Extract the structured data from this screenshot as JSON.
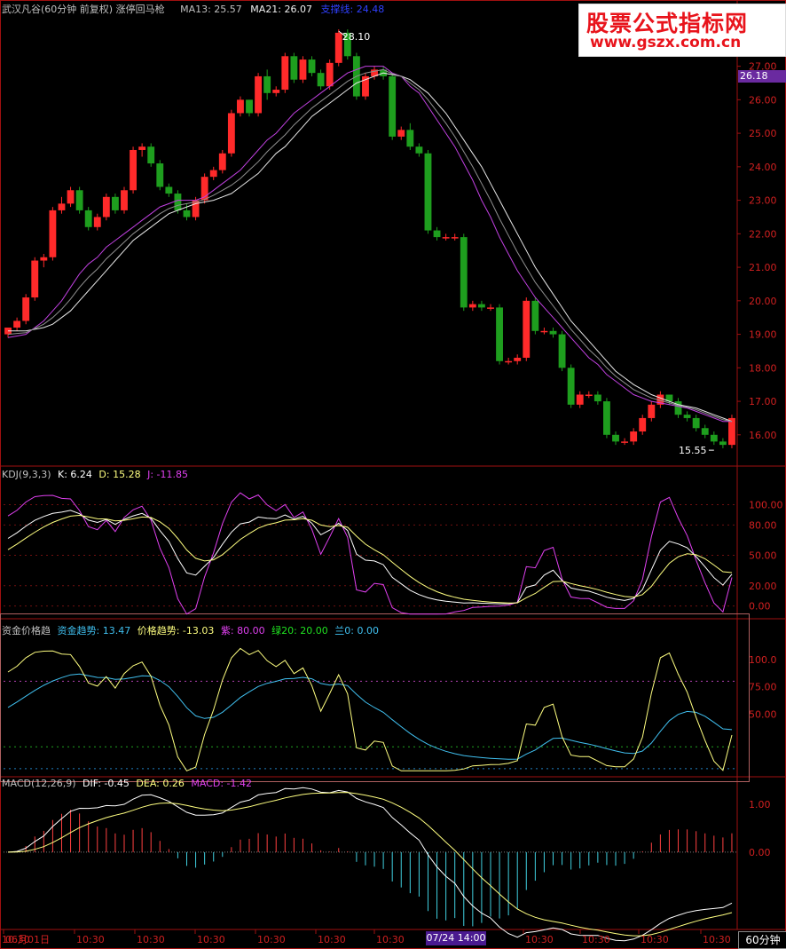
{
  "main_header": {
    "title": "武汉凡谷(60分钟 前复权) 涨停回马枪",
    "ma13_label": "MA13: 25.57",
    "ma21_label": "MA21: 26.07",
    "support_label": "支撑线: 24.48"
  },
  "watermark": {
    "line1": "股票公式指标网",
    "line2": "www.gszx.com.cn"
  },
  "current_price": "26.18",
  "annotations": {
    "high": "28.10",
    "low": "15.55"
  },
  "kdj_header": {
    "name": "KDJ(9,3,3)",
    "k": "K: 6.24",
    "d": "D: 15.28",
    "j": "J: -11.85"
  },
  "fund_header": {
    "name": "资金价格趋",
    "fund": "资金趋势: 13.47",
    "price": "价格趋势: -13.03",
    "purple": "紫: 80.00",
    "green": "绿20: 20.00",
    "blue": "兰0: 0.00"
  },
  "macd_header": {
    "name": "MACD(12,26,9)",
    "dif": "DIF: -0.45",
    "dea": "DEA: 0.26",
    "macd": "MACD: -1.42"
  },
  "x_axis": {
    "labels": [
      "06月01日",
      "10:30",
      "10:30",
      "10:30",
      "10:30",
      "10:30",
      "10:30",
      "10:30",
      "07/24 14:00",
      "10:30",
      "10:30",
      "10:30",
      "10:30",
      "10:30"
    ],
    "highlight": "07/24 14:00",
    "period": "60分钟"
  },
  "colors": {
    "up": "#ff2a2a",
    "down": "#1e9e1e",
    "bg": "#000000",
    "border": "#a01010",
    "ma_white": "#e8e8e8",
    "ma_purple": "#c040e0",
    "ma_gray": "#909090",
    "kdj_k": "#ffffff",
    "kdj_d": "#ffff80",
    "kdj_j": "#e040f0",
    "fund_line": "#40c0f0",
    "price_line": "#ffff80",
    "macd_dif": "#ffffff",
    "macd_dea": "#ffff80",
    "macd_pos": "#ff4040",
    "macd_neg": "#40d0e0"
  },
  "chart_data": [
    {
      "type": "candlestick",
      "title": "武汉凡谷(60分钟 前复权)",
      "ylim": [
        15.2,
        28.5
      ],
      "yticks": [
        "27.00",
        "26.00",
        "25.00",
        "24.00",
        "23.00",
        "22.00",
        "21.00",
        "20.00",
        "19.00",
        "18.00",
        "17.00",
        "16.00"
      ],
      "candles": [
        [
          19.0,
          19.2,
          18.9,
          19.2
        ],
        [
          19.2,
          19.5,
          19.1,
          19.4
        ],
        [
          19.4,
          20.2,
          19.3,
          20.1
        ],
        [
          20.1,
          21.3,
          20.0,
          21.2
        ],
        [
          21.2,
          21.4,
          21.0,
          21.3
        ],
        [
          21.3,
          22.8,
          21.2,
          22.7
        ],
        [
          22.7,
          23.1,
          22.6,
          22.9
        ],
        [
          22.9,
          23.4,
          22.8,
          23.3
        ],
        [
          23.3,
          23.4,
          22.6,
          22.7
        ],
        [
          22.7,
          22.8,
          22.1,
          22.2
        ],
        [
          22.2,
          22.6,
          22.1,
          22.5
        ],
        [
          22.5,
          23.2,
          22.4,
          23.1
        ],
        [
          23.1,
          23.2,
          22.6,
          22.7
        ],
        [
          22.7,
          23.4,
          22.6,
          23.3
        ],
        [
          23.3,
          24.6,
          23.2,
          24.5
        ],
        [
          24.5,
          24.7,
          24.3,
          24.6
        ],
        [
          24.6,
          24.7,
          24.0,
          24.1
        ],
        [
          24.1,
          24.2,
          23.3,
          23.4
        ],
        [
          23.4,
          23.5,
          23.1,
          23.2
        ],
        [
          23.2,
          23.3,
          22.6,
          22.7
        ],
        [
          22.7,
          22.9,
          22.4,
          22.5
        ],
        [
          22.5,
          23.1,
          22.4,
          23.0
        ],
        [
          23.0,
          23.8,
          22.9,
          23.7
        ],
        [
          23.7,
          24.0,
          23.6,
          23.9
        ],
        [
          23.9,
          24.5,
          23.8,
          24.4
        ],
        [
          24.4,
          25.7,
          24.3,
          25.6
        ],
        [
          25.6,
          26.1,
          25.5,
          26.0
        ],
        [
          26.0,
          26.0,
          25.5,
          25.6
        ],
        [
          25.6,
          26.8,
          25.5,
          26.7
        ],
        [
          26.7,
          26.9,
          26.0,
          26.2
        ],
        [
          26.2,
          26.4,
          26.1,
          26.3
        ],
        [
          26.3,
          27.4,
          26.2,
          27.3
        ],
        [
          27.3,
          27.4,
          26.5,
          26.6
        ],
        [
          26.6,
          27.3,
          26.5,
          27.2
        ],
        [
          27.2,
          27.3,
          26.7,
          26.8
        ],
        [
          26.8,
          26.9,
          26.3,
          26.4
        ],
        [
          26.4,
          27.2,
          26.3,
          27.1
        ],
        [
          27.1,
          28.1,
          27.0,
          28.0
        ],
        [
          28.0,
          28.1,
          27.2,
          27.3
        ],
        [
          27.3,
          27.4,
          26.0,
          26.1
        ],
        [
          26.1,
          26.8,
          26.0,
          26.7
        ],
        [
          26.7,
          27.0,
          26.6,
          26.9
        ],
        [
          26.9,
          27.0,
          26.6,
          26.7
        ],
        [
          26.7,
          26.8,
          24.8,
          24.9
        ],
        [
          24.9,
          25.2,
          24.8,
          25.1
        ],
        [
          25.1,
          25.3,
          24.5,
          24.6
        ],
        [
          24.6,
          24.7,
          24.3,
          24.4
        ],
        [
          24.4,
          24.5,
          22.0,
          22.1
        ],
        [
          22.1,
          22.2,
          21.8,
          21.9
        ],
        [
          21.9,
          22.0,
          21.8,
          21.9
        ],
        [
          21.9,
          22.0,
          21.8,
          21.9
        ],
        [
          21.9,
          22.0,
          19.7,
          19.8
        ],
        [
          19.8,
          20.0,
          19.7,
          19.9
        ],
        [
          19.9,
          20.0,
          19.7,
          19.8
        ],
        [
          19.8,
          19.9,
          19.7,
          19.8
        ],
        [
          19.8,
          19.9,
          18.1,
          18.2
        ],
        [
          18.2,
          18.3,
          18.1,
          18.2
        ],
        [
          18.2,
          18.4,
          18.1,
          18.3
        ],
        [
          18.3,
          20.1,
          18.2,
          20.0
        ],
        [
          20.0,
          20.1,
          19.0,
          19.1
        ],
        [
          19.1,
          19.2,
          19.0,
          19.1
        ],
        [
          19.1,
          19.2,
          18.9,
          19.0
        ],
        [
          19.0,
          19.1,
          17.9,
          18.0
        ],
        [
          18.0,
          18.1,
          16.8,
          16.9
        ],
        [
          16.9,
          17.3,
          16.8,
          17.2
        ],
        [
          17.2,
          17.3,
          17.1,
          17.2
        ],
        [
          17.2,
          17.3,
          16.9,
          17.0
        ],
        [
          17.0,
          17.1,
          15.9,
          16.0
        ],
        [
          16.0,
          16.1,
          15.7,
          15.8
        ],
        [
          15.8,
          15.9,
          15.7,
          15.8
        ],
        [
          15.8,
          16.2,
          15.7,
          16.1
        ],
        [
          16.1,
          16.6,
          16.0,
          16.5
        ],
        [
          16.5,
          17.0,
          16.4,
          16.9
        ],
        [
          16.9,
          17.3,
          16.8,
          17.2
        ],
        [
          17.2,
          17.2,
          16.9,
          17.0
        ],
        [
          17.0,
          17.1,
          16.5,
          16.6
        ],
        [
          16.6,
          16.7,
          16.4,
          16.5
        ],
        [
          16.5,
          16.6,
          16.1,
          16.2
        ],
        [
          16.2,
          16.3,
          15.9,
          16.0
        ],
        [
          16.0,
          16.1,
          15.7,
          15.8
        ],
        [
          15.8,
          15.9,
          15.6,
          15.7
        ],
        [
          15.7,
          16.6,
          15.6,
          16.5
        ]
      ],
      "series": [
        {
          "name": "MA13",
          "values": [
            18.9,
            18.95,
            19.0,
            19.2,
            19.4,
            19.7,
            20.0,
            20.4,
            20.8,
            21.1,
            21.3,
            21.6,
            21.8,
            22.0,
            22.2,
            22.4,
            22.6,
            22.8,
            22.9,
            23.0,
            23.0,
            23.0,
            23.1,
            23.3,
            23.5,
            23.7,
            23.9,
            24.2,
            24.5,
            24.8,
            25.0,
            25.3,
            25.6,
            25.8,
            26.0,
            26.2,
            26.4,
            26.6,
            26.8,
            26.9,
            27.0,
            27.0,
            27.0,
            26.8,
            26.7,
            26.4,
            26.2,
            25.8,
            25.4,
            25.0,
            24.6,
            24.1,
            23.6,
            23.0,
            22.5,
            21.9,
            21.4,
            20.9,
            20.5,
            20.1,
            19.8,
            19.5,
            19.2,
            18.9,
            18.6,
            18.3,
            18.1,
            17.8,
            17.6,
            17.4,
            17.2,
            17.1,
            17.0,
            16.95,
            16.9,
            16.85,
            16.8,
            16.7,
            16.6,
            16.5,
            16.4,
            16.4
          ]
        },
        {
          "name": "MA21",
          "values": [
            19.1,
            19.1,
            19.1,
            19.15,
            19.2,
            19.3,
            19.5,
            19.7,
            20.0,
            20.3,
            20.6,
            20.9,
            21.2,
            21.5,
            21.8,
            22.0,
            22.2,
            22.4,
            22.6,
            22.7,
            22.8,
            22.9,
            22.95,
            23.0,
            23.1,
            23.2,
            23.4,
            23.6,
            23.8,
            24.1,
            24.4,
            24.6,
            24.9,
            25.2,
            25.5,
            25.7,
            25.9,
            26.1,
            26.3,
            26.5,
            26.6,
            26.7,
            26.8,
            26.75,
            26.7,
            26.6,
            26.4,
            26.2,
            25.9,
            25.6,
            25.2,
            24.8,
            24.4,
            24.0,
            23.5,
            23.0,
            22.5,
            22.0,
            21.5,
            21.0,
            20.6,
            20.2,
            19.8,
            19.4,
            19.1,
            18.8,
            18.5,
            18.2,
            17.9,
            17.7,
            17.5,
            17.35,
            17.2,
            17.1,
            17.0,
            16.9,
            16.85,
            16.8,
            16.7,
            16.6,
            16.5,
            16.4
          ]
        }
      ]
    },
    {
      "type": "line",
      "title": "KDJ(9,3,3)",
      "ylim": [
        -10,
        125
      ],
      "yticks": [
        "100.00",
        "80.00",
        "50.00",
        "20.00",
        "0.00"
      ],
      "series": [
        {
          "name": "K"
        },
        {
          "name": "D"
        },
        {
          "name": "J"
        }
      ]
    },
    {
      "type": "line",
      "title": "资金价格趋",
      "ylim": [
        -5,
        125
      ],
      "yticks": [
        "100.0",
        "75.00",
        "50.00"
      ],
      "series": [
        {
          "name": "资金趋势"
        },
        {
          "name": "价格趋势"
        }
      ]
    },
    {
      "type": "bar",
      "title": "MACD(12,26,9)",
      "ylim": [
        -1.6,
        1.3
      ],
      "yticks": [
        "1.00",
        "0.00"
      ],
      "series": [
        {
          "name": "DIF"
        },
        {
          "name": "DEA"
        },
        {
          "name": "MACD"
        }
      ]
    }
  ]
}
